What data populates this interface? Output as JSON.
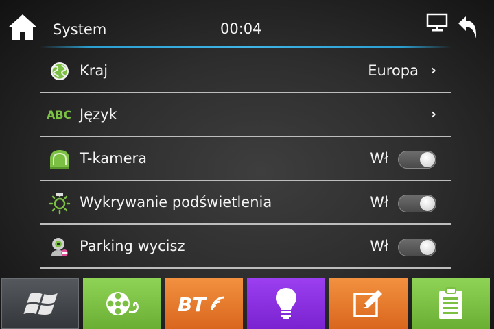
{
  "header": {
    "title": "System",
    "clock": "00:04"
  },
  "rows": [
    {
      "id": "country",
      "icon": "globe-icon",
      "label": "Kraj",
      "value": "Europa"
    },
    {
      "id": "language",
      "icon": "abc-icon",
      "icon_text": "ABC",
      "label": "Język"
    },
    {
      "id": "t-camera",
      "icon": "camera-dome-icon",
      "label": "T-kamera",
      "state": "Wł",
      "on": true
    },
    {
      "id": "backlight",
      "icon": "sun-detect-icon",
      "label": "Wykrywanie podświetlenia",
      "state": "Wł",
      "on": true
    },
    {
      "id": "parking-mute",
      "icon": "parking-camera-icon",
      "label": "Parking wycisz",
      "state": "Wł",
      "on": true
    }
  ],
  "dock": [
    {
      "id": "windows",
      "icon": "windows-icon",
      "color": "#3d4044"
    },
    {
      "id": "media",
      "icon": "film-reel-icon",
      "color": "#7bc043"
    },
    {
      "id": "bluetooth",
      "icon": "bt-icon",
      "color": "#e8782a"
    },
    {
      "id": "light",
      "icon": "bulb-icon",
      "color": "#8a2be2"
    },
    {
      "id": "notes",
      "icon": "edit-icon",
      "color": "#e8782a"
    },
    {
      "id": "clipboard",
      "icon": "clipboard-icon",
      "color": "#7bc043"
    }
  ],
  "colors": {
    "accent_line": "#3fb6e6",
    "icon_green": "#7bc043"
  }
}
